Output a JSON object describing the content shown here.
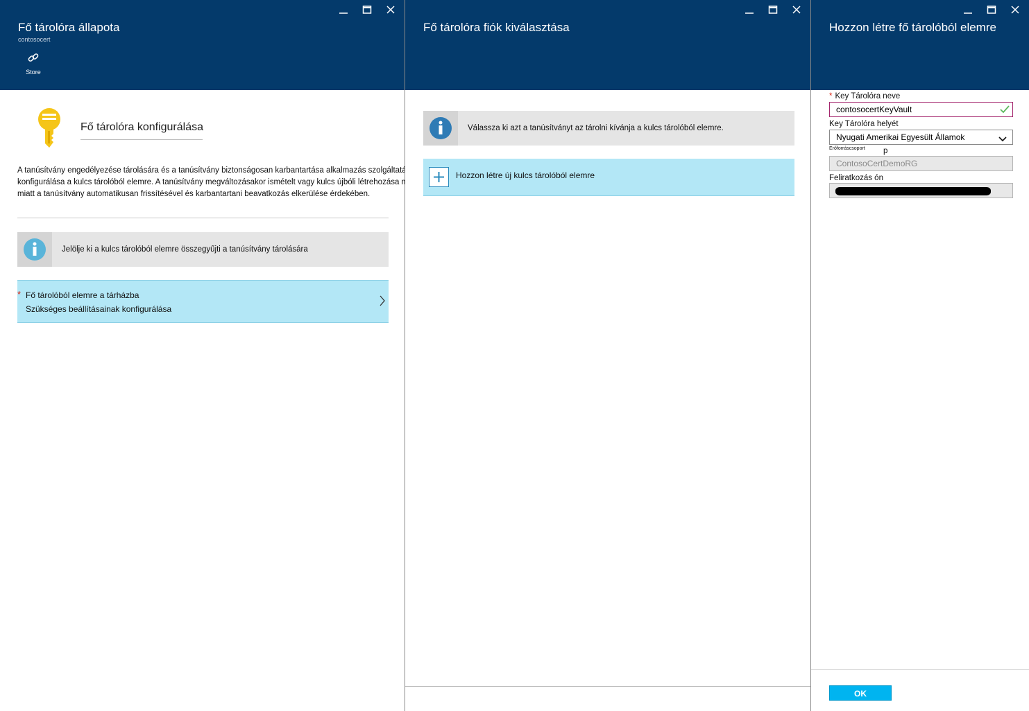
{
  "blade1": {
    "title": "Fő tárolóra állapota",
    "subtitle": "contosocert",
    "command_store_label": "Store",
    "hero_title": "Fő tárolóra konfigurálása",
    "description": "A tanúsítvány engedélyezése tárolására és a tanúsítvány biztonságosan karbantartása alkalmazás szolgáltatások konfigurálása a kulcs tárolóból elemre. A tanúsítvány megváltozásakor ismételt vagy kulcs újbóli létrehozása művelet miatt a tanúsítvány automatikusan frissítésével és karbantartani beavatkozás elkerülése érdekében.",
    "info_text": "Jelölje ki a kulcs tárolóból elemre összegyűjti a tanúsítvány tárolására",
    "nav_item": {
      "required_mark": "*",
      "title": "Fő tárolóból elemre a tárházba",
      "subtitle": "Szükséges beállításainak konfigurálása"
    }
  },
  "blade2": {
    "title": "Fő tárolóra fiók kiválasztása",
    "info_text": "Válassza ki azt a tanúsítványt az tárolni kívánja a kulcs tárolóból elemre.",
    "create_label": "Hozzon létre új kulcs tárolóból elemre"
  },
  "blade3": {
    "title": "Hozzon létre fő tárolóból elemre",
    "name_label": "Key Tárolóra neve",
    "name_required_mark": "*",
    "name_value": "contosocertKeyVault",
    "location_label": "Key Tárolóra helyét",
    "location_value": "Nyugati Amerikai Egyesült Államok",
    "resource_group_label": "Erőforráscsoport",
    "resource_group_suffix": "p",
    "resource_group_value": "ContosoCertDemoRG",
    "subscription_label": "Feliratkozás ón",
    "ok_label": "OK"
  },
  "colors": {
    "header_bg": "#043a6b",
    "nav_row_bg": "#b3e7f6",
    "info_bg": "#e5e5e5",
    "ok_button": "#00b4f0",
    "required": "#dd2211",
    "key_icon": "#f5c518"
  },
  "icons": {
    "window_controls": [
      "minimize-icon",
      "maximize-icon",
      "close-icon"
    ],
    "store": "link-icon",
    "hero": "key-icon",
    "info": "info-icon",
    "chevron": "chevron-right-icon",
    "create": "plus-icon",
    "valid": "checkmark-icon",
    "dropdown": "chevron-down-icon"
  }
}
